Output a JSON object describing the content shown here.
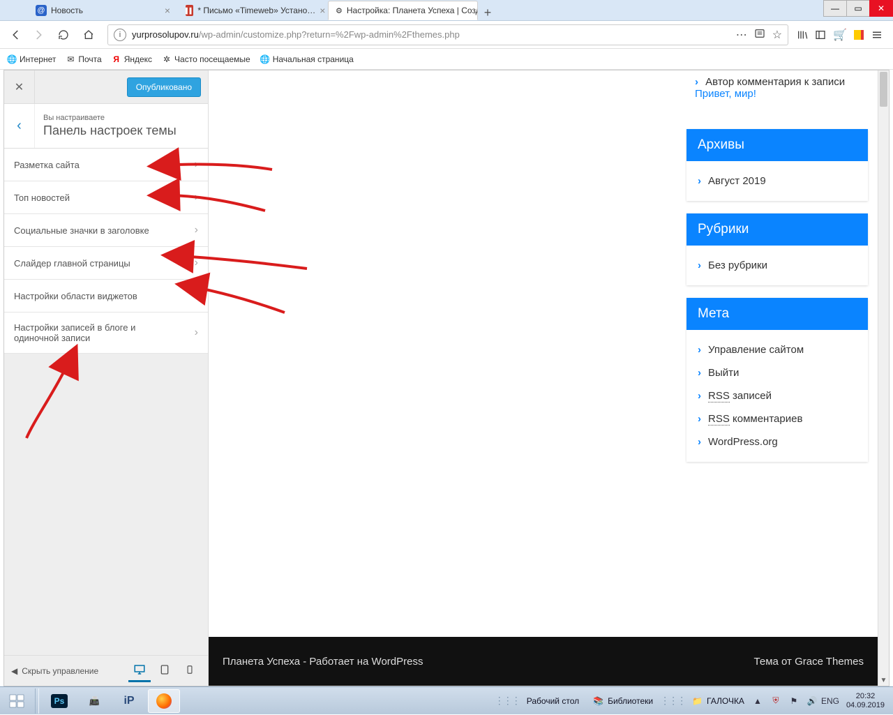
{
  "window": {
    "tabs": [
      {
        "title": "Новость",
        "icon_bg": "#2a63c9"
      },
      {
        "title": "* Письмо «Timeweb» Устано…",
        "icon_bg": "#c73a2d"
      },
      {
        "title": "Настройка: Планета Успеха | Созд…",
        "icon_bg": "#444"
      }
    ],
    "active_tab": 2
  },
  "url": {
    "host": "yurprosolupov.ru",
    "path": "/wp-admin/customize.php?return=%2Fwp-admin%2Fthemes.php"
  },
  "bookmarks": [
    {
      "label": "Интернет",
      "icon": "globe"
    },
    {
      "label": "Почта",
      "icon": "mail"
    },
    {
      "label": "Яндекс",
      "icon": "yandex"
    },
    {
      "label": "Часто посещаемые",
      "icon": "gear"
    },
    {
      "label": "Начальная страница",
      "icon": "globe"
    }
  ],
  "customizer": {
    "publish_label": "Опубликовано",
    "subtitle": "Вы настраиваете",
    "title": "Панель настроек темы",
    "items": [
      "Разметка сайта",
      "Топ новостей",
      "Социальные значки в заголовке",
      "Слайдер главной страницы",
      "Настройки области виджетов",
      "Настройки записей в блоге и одиночной записи"
    ],
    "collapse_label": "Скрыть управление"
  },
  "preview": {
    "comment_prefix": "Автор комментария",
    "comment_mid": " к записи ",
    "comment_link": "Привет, мир!",
    "widgets": [
      {
        "title": "Архивы",
        "items": [
          "Август 2019"
        ]
      },
      {
        "title": "Рубрики",
        "items": [
          "Без рубрики"
        ]
      },
      {
        "title": "Мета",
        "items": [
          "Управление сайтом",
          "Выйти",
          "RSS записей",
          "RSS комментариев",
          "WordPress.org"
        ]
      }
    ],
    "footer_left": "Планета Успеха - Работает на WordPress",
    "footer_right": "Тема от Grace Themes"
  },
  "taskbar": {
    "tasks": [
      {
        "label": "Рабочий стол"
      },
      {
        "label": "Библиотеки"
      },
      {
        "label": "ГАЛОЧКА"
      }
    ],
    "lang": "ENG",
    "time": "20:32",
    "date": "04.09.2019"
  }
}
